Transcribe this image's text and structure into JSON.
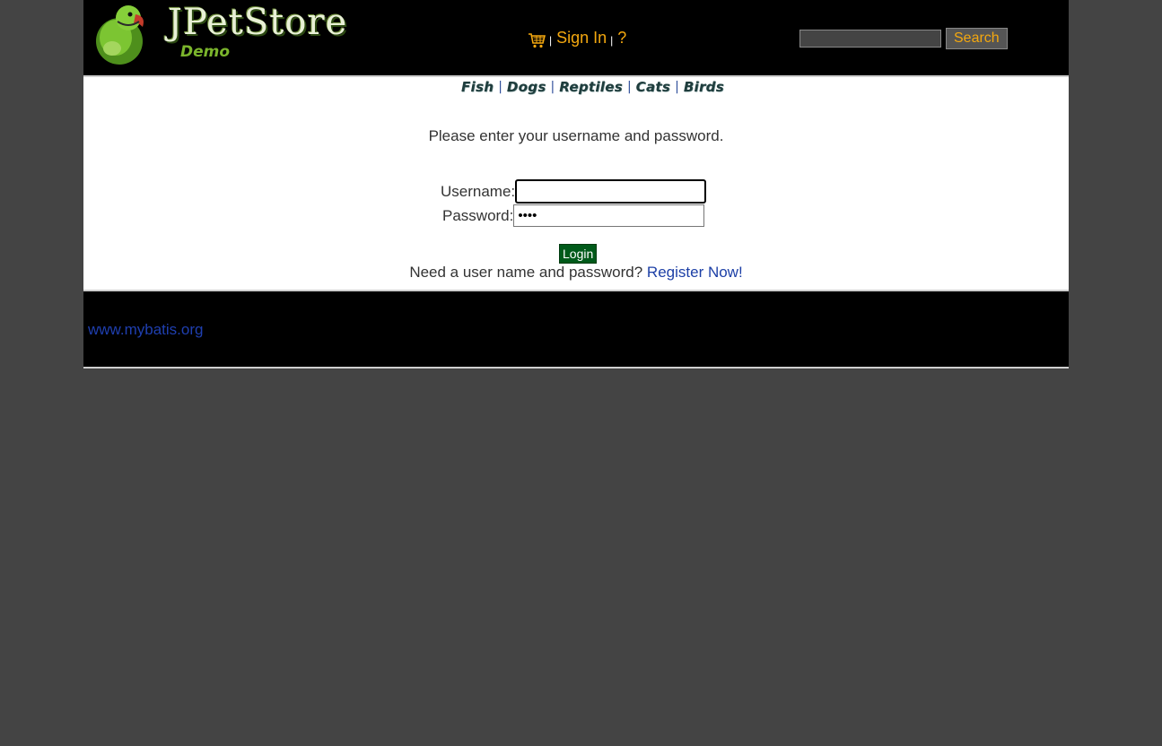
{
  "header": {
    "logo_title": "JPetStore",
    "logo_subtitle": "Demo",
    "menu": {
      "sign_in": "Sign In",
      "help": "?",
      "separator": "|"
    },
    "search": {
      "value": "",
      "button_label": "Search"
    }
  },
  "quicklinks": [
    "Fish",
    "Dogs",
    "Reptiles",
    "Cats",
    "Birds"
  ],
  "login": {
    "prompt": "Please enter your username and password.",
    "username_label": "Username:",
    "username_value": "",
    "password_label": "Password:",
    "password_value": "••••",
    "button_label": "Login",
    "register_text": "Need a user name and password?",
    "register_link": "Register Now!"
  },
  "footer": {
    "link": "www.mybatis.org"
  },
  "colors": {
    "background": "#444444",
    "header_bg": "#000000",
    "menu_accent": "#f4a80f",
    "login_button": "#005a1a",
    "link": "#1c3fa6"
  },
  "icons": [
    "parrot-logo-icon",
    "cart-icon"
  ]
}
